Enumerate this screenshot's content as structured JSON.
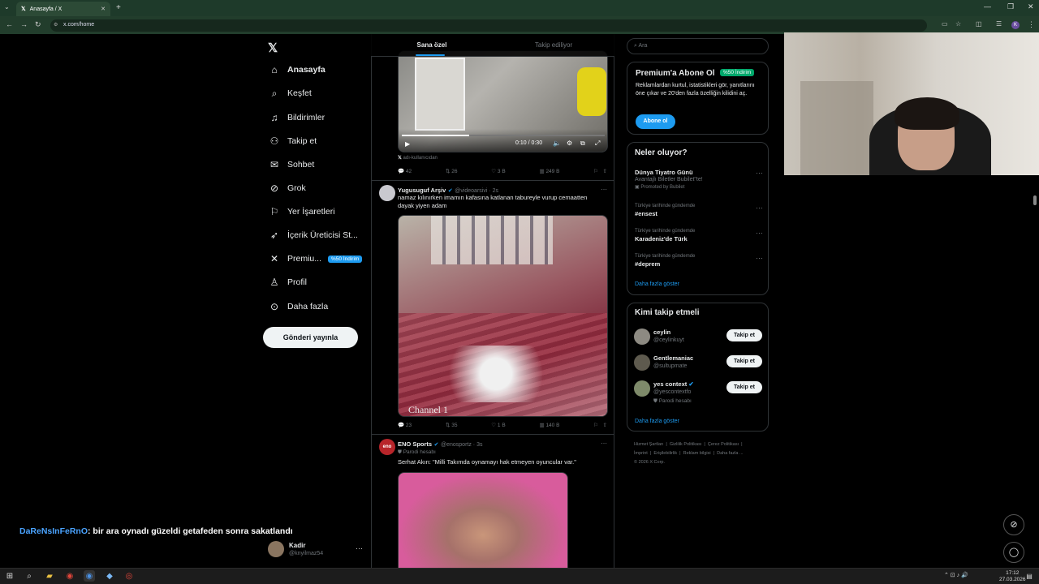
{
  "browser": {
    "tab_title": "Anasayfa / X",
    "url": "x.com/home"
  },
  "nav": {
    "items": [
      {
        "label": "Anasayfa",
        "icon": "home-icon"
      },
      {
        "label": "Keşfet",
        "icon": "search-icon"
      },
      {
        "label": "Bildirimler",
        "icon": "bell-icon"
      },
      {
        "label": "Takip et",
        "icon": "add-person-icon"
      },
      {
        "label": "Sohbet",
        "icon": "mail-icon"
      },
      {
        "label": "Grok",
        "icon": "grok-icon"
      },
      {
        "label": "Yer İşaretleri",
        "icon": "bookmark-icon"
      },
      {
        "label": "İçerik Üreticisi St...",
        "icon": "rocket-icon"
      },
      {
        "label": "Premiu...",
        "icon": "x-icon"
      },
      {
        "label": "Profil",
        "icon": "person-icon"
      },
      {
        "label": "Daha fazla",
        "icon": "more-circle-icon"
      }
    ],
    "premium_badge": "%50 İndirim",
    "post_button": "Gönderi yayınla",
    "account_name": "Kadir",
    "account_handle": "@knyilmaz54"
  },
  "feed": {
    "tabs": [
      "Sana özel",
      "Takip ediliyor"
    ],
    "video_time": "0:10 / 0:30",
    "video_source": "adı-kullanıcıdan",
    "tweet0_actions": [
      "42",
      "26",
      "3 B",
      "249 B"
    ],
    "tweet1": {
      "name": "Yugusuguf Arşiv",
      "handle": "@videoarsivi · 2s",
      "text": "namaz kılınırken imamın kafasına katlanan tabureyle vurup cemaatten dayak yiyen adam",
      "watermark": "Channel 1",
      "actions": [
        "23",
        "35",
        "1 B",
        "140 B"
      ]
    },
    "tweet2": {
      "name": "ENO Sports",
      "handle": "@enosportz · 3s",
      "parody": "Parodi hesabı",
      "text": "Serhat Akın: \"Milli Takımda oynamayı hak etmeyen oyuncular var.\""
    }
  },
  "sidebar": {
    "search_placeholder": "Ara",
    "premium": {
      "title": "Premium'a Abone Ol",
      "badge": "%50 İndirim",
      "desc": "Reklamlardan kurtul, istatistikleri gör, yanıtlarını öne çıkar ve 20'den fazla özelliğin kilidini aç.",
      "button": "Abone ol"
    },
    "trends": {
      "title": "Neler oluyor?",
      "items": [
        {
          "title": "Dünya Tiyatro Günü",
          "sub": "Avantajlı Biletler Bubilet\"te!",
          "promo": "Promoted by Bubilet"
        },
        {
          "sub": "Türkiye tarihinde gündemde",
          "title": "#ensest"
        },
        {
          "sub": "Türkiye tarihinde gündemde",
          "title": "Karadeniz'de Türk"
        },
        {
          "sub": "Türkiye tarihinde gündemde",
          "title": "#deprem"
        }
      ],
      "more": "Daha fazla göster"
    },
    "who": {
      "title": "Kimi takip etmeli",
      "users": [
        {
          "name": "ceylin",
          "handle": "@ceylinkuyt",
          "extra": ""
        },
        {
          "name": "Gentlemaniac",
          "handle": "@sultupmate",
          "extra": ""
        },
        {
          "name": "yes context",
          "handle": "@yescontextfo",
          "extra": "Parodi hesabı"
        }
      ],
      "follow": "Takip et",
      "more": "Daha fazla göster"
    },
    "footer": [
      "Hizmet Şartları",
      "Gizlilik Politikası",
      "Çerez Politikası",
      "İmprint",
      "Erişilebilirlik",
      "Reklam bilgisi",
      "Daha fazla ...",
      "© 2026 X Corp."
    ]
  },
  "overlay": {
    "chat_user": "DaReNsInFeRnO",
    "chat_text": ": bir ara oynadı güzeldi getafeden sonra sakatlandı"
  },
  "taskbar": {
    "time": "17:12",
    "date": "27.03.2026"
  },
  "colors": {
    "accent": "#1d9bf0",
    "background": "#000000",
    "chrome": "#1e3a2a"
  }
}
